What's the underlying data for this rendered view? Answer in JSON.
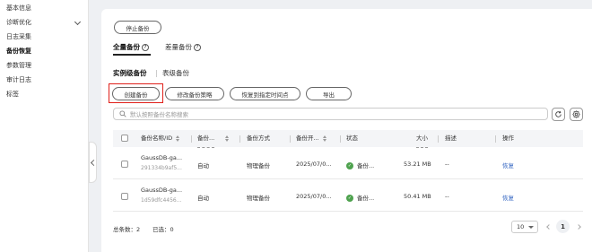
{
  "sidebar": {
    "items": [
      {
        "label": "基本信息"
      },
      {
        "label": "诊断优化"
      },
      {
        "label": "日志采集"
      },
      {
        "label": "备份恢复"
      },
      {
        "label": "参数管理"
      },
      {
        "label": "审计日志"
      },
      {
        "label": "标签"
      }
    ],
    "active_index": 3
  },
  "top_button": "停止备份",
  "tabs": [
    {
      "label": "全量备份",
      "active": true
    },
    {
      "label": "差量备份",
      "active": false
    }
  ],
  "subtabs": [
    {
      "label": "实例级备份",
      "active": true
    },
    {
      "label": "表级备份",
      "active": false
    }
  ],
  "actions": {
    "create": "创建备份",
    "modify_policy": "修改备份策略",
    "restore_point": "恢复到指定时间点",
    "export": "导出"
  },
  "search": {
    "placeholder": "默认按照备份名称搜索"
  },
  "table": {
    "columns": [
      "备份名称/ID",
      "备份...",
      "备份方式",
      "备份开...",
      "状态",
      "大小",
      "描述",
      "操作"
    ],
    "rows": [
      {
        "name": "GaussDB-ga...",
        "id": "291334b9af5...",
        "type": "自动",
        "method": "物理备份",
        "start": "2025/07/0...",
        "status": "备份...",
        "size": "53.21 MB",
        "desc": "--",
        "action": "恢复"
      },
      {
        "name": "GaussDB-ga...",
        "id": "1d59dfc4456...",
        "type": "自动",
        "method": "物理备份",
        "start": "2025/07/0...",
        "status": "备份...",
        "size": "50.41 MB",
        "desc": "--",
        "action": "恢复"
      }
    ]
  },
  "footer": {
    "total": "总条数：2",
    "selected": "已选：0",
    "page_size": "10",
    "page": "1"
  }
}
